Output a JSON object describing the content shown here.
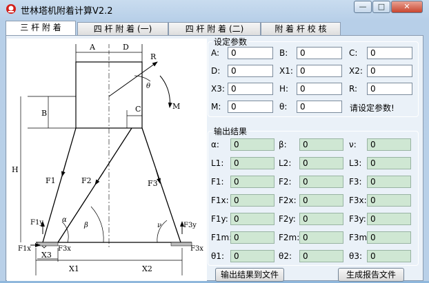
{
  "window": {
    "title": "世林塔机附着计算V2.2"
  },
  "controls": {
    "minimize": "—",
    "maximize": "□",
    "close": "✕"
  },
  "tabs": [
    "三 杆 附 着",
    "四 杆 附 着 (一)",
    "四 杆 附 着 (二)",
    "附 着 杆 校 核"
  ],
  "settings": {
    "title": "设定参数",
    "fields": [
      {
        "label": "A:",
        "value": "0"
      },
      {
        "label": "B:",
        "value": "0"
      },
      {
        "label": "C:",
        "value": "0"
      },
      {
        "label": "D:",
        "value": "0"
      },
      {
        "label": "X1:",
        "value": "0"
      },
      {
        "label": "X2:",
        "value": "0"
      },
      {
        "label": "X3:",
        "value": "0"
      },
      {
        "label": "H:",
        "value": "0"
      },
      {
        "label": "R:",
        "value": "0"
      },
      {
        "label": "M:",
        "value": "0"
      },
      {
        "label": "θ:",
        "value": "0"
      }
    ],
    "hint": "请设定参数!"
  },
  "results": {
    "title": "输出结果",
    "fields": [
      {
        "label": "α:",
        "value": "0"
      },
      {
        "label": "β:",
        "value": "0"
      },
      {
        "label": "ν:",
        "value": "0"
      },
      {
        "label": "L1:",
        "value": "0"
      },
      {
        "label": "L2:",
        "value": "0"
      },
      {
        "label": "L3:",
        "value": "0"
      },
      {
        "label": "F1:",
        "value": "0"
      },
      {
        "label": "F2:",
        "value": "0"
      },
      {
        "label": "F3:",
        "value": "0"
      },
      {
        "label": "F1x:",
        "value": "0"
      },
      {
        "label": "F2x:",
        "value": "0"
      },
      {
        "label": "F3x:",
        "value": "0"
      },
      {
        "label": "F1y:",
        "value": "0"
      },
      {
        "label": "F2y:",
        "value": "0"
      },
      {
        "label": "F3y:",
        "value": "0"
      },
      {
        "label": "F1m:",
        "value": "0"
      },
      {
        "label": "F2m:",
        "value": "0"
      },
      {
        "label": "F3m:",
        "value": "0"
      },
      {
        "label": "θ1:",
        "value": "0"
      },
      {
        "label": "θ2:",
        "value": "0"
      },
      {
        "label": "θ3:",
        "value": "0"
      }
    ]
  },
  "buttons": {
    "export": "输出结果到文件",
    "report": "生成报告文件"
  },
  "diagram_labels": {
    "A": "A",
    "D": "D",
    "R": "R",
    "theta": "θ",
    "M": "M",
    "B": "B",
    "C": "C",
    "H": "H",
    "F1": "F1",
    "F2": "F2",
    "F3": "F3",
    "alpha": "α",
    "beta": "β",
    "nu": "ν",
    "F1y": "F1y",
    "F1x": "F1x",
    "F3x_left": "F3x",
    "F3y": "F3y",
    "F3x_right": "F3x",
    "X3": "X3",
    "X1": "X1",
    "X2": "X2"
  }
}
